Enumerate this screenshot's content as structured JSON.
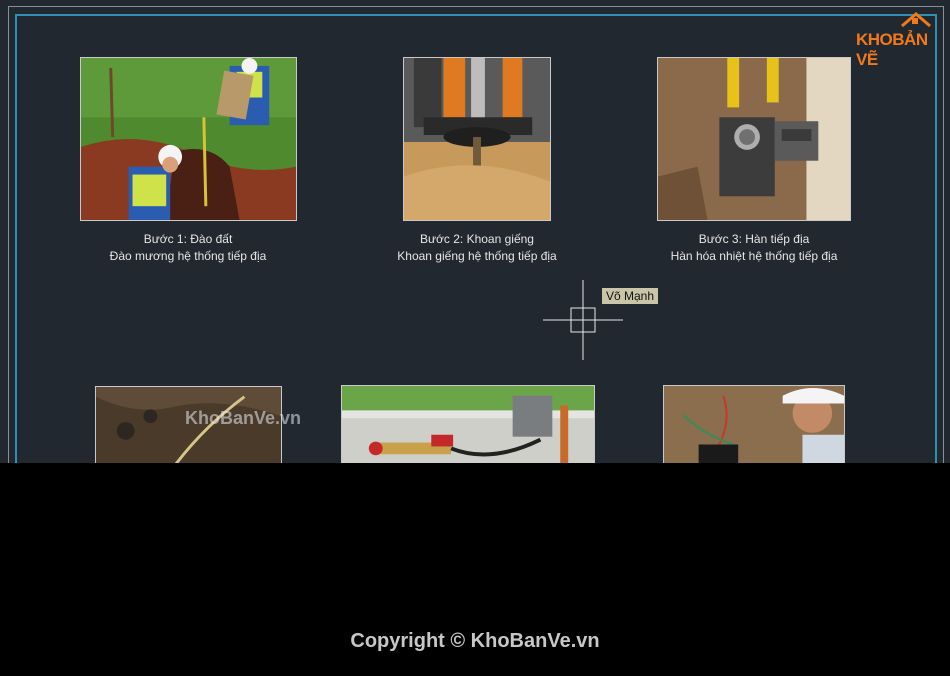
{
  "logo": {
    "part1": "KHO",
    "part2": "BẢN VẼ"
  },
  "steps": [
    {
      "title": "Bước 1: Đào đất",
      "desc": "Đào mương hệ thống tiếp địa"
    },
    {
      "title": "Bước 2: Khoan giếng",
      "desc": "Khoan giếng hệ thống tiếp địa"
    },
    {
      "title": "Bước 3: Hàn tiếp địa",
      "desc": "Hàn hóa nhiệt hệ thống tiếp địa"
    }
  ],
  "cursor_tooltip": "Võ Mạnh",
  "watermark": "KhoBanVe.vn",
  "copyright": "Copyright © KhoBanVe.vn",
  "colors": {
    "canvas": "#212830",
    "frame_accent": "#2f8fb3",
    "logo_orange": "#f07a1a"
  }
}
